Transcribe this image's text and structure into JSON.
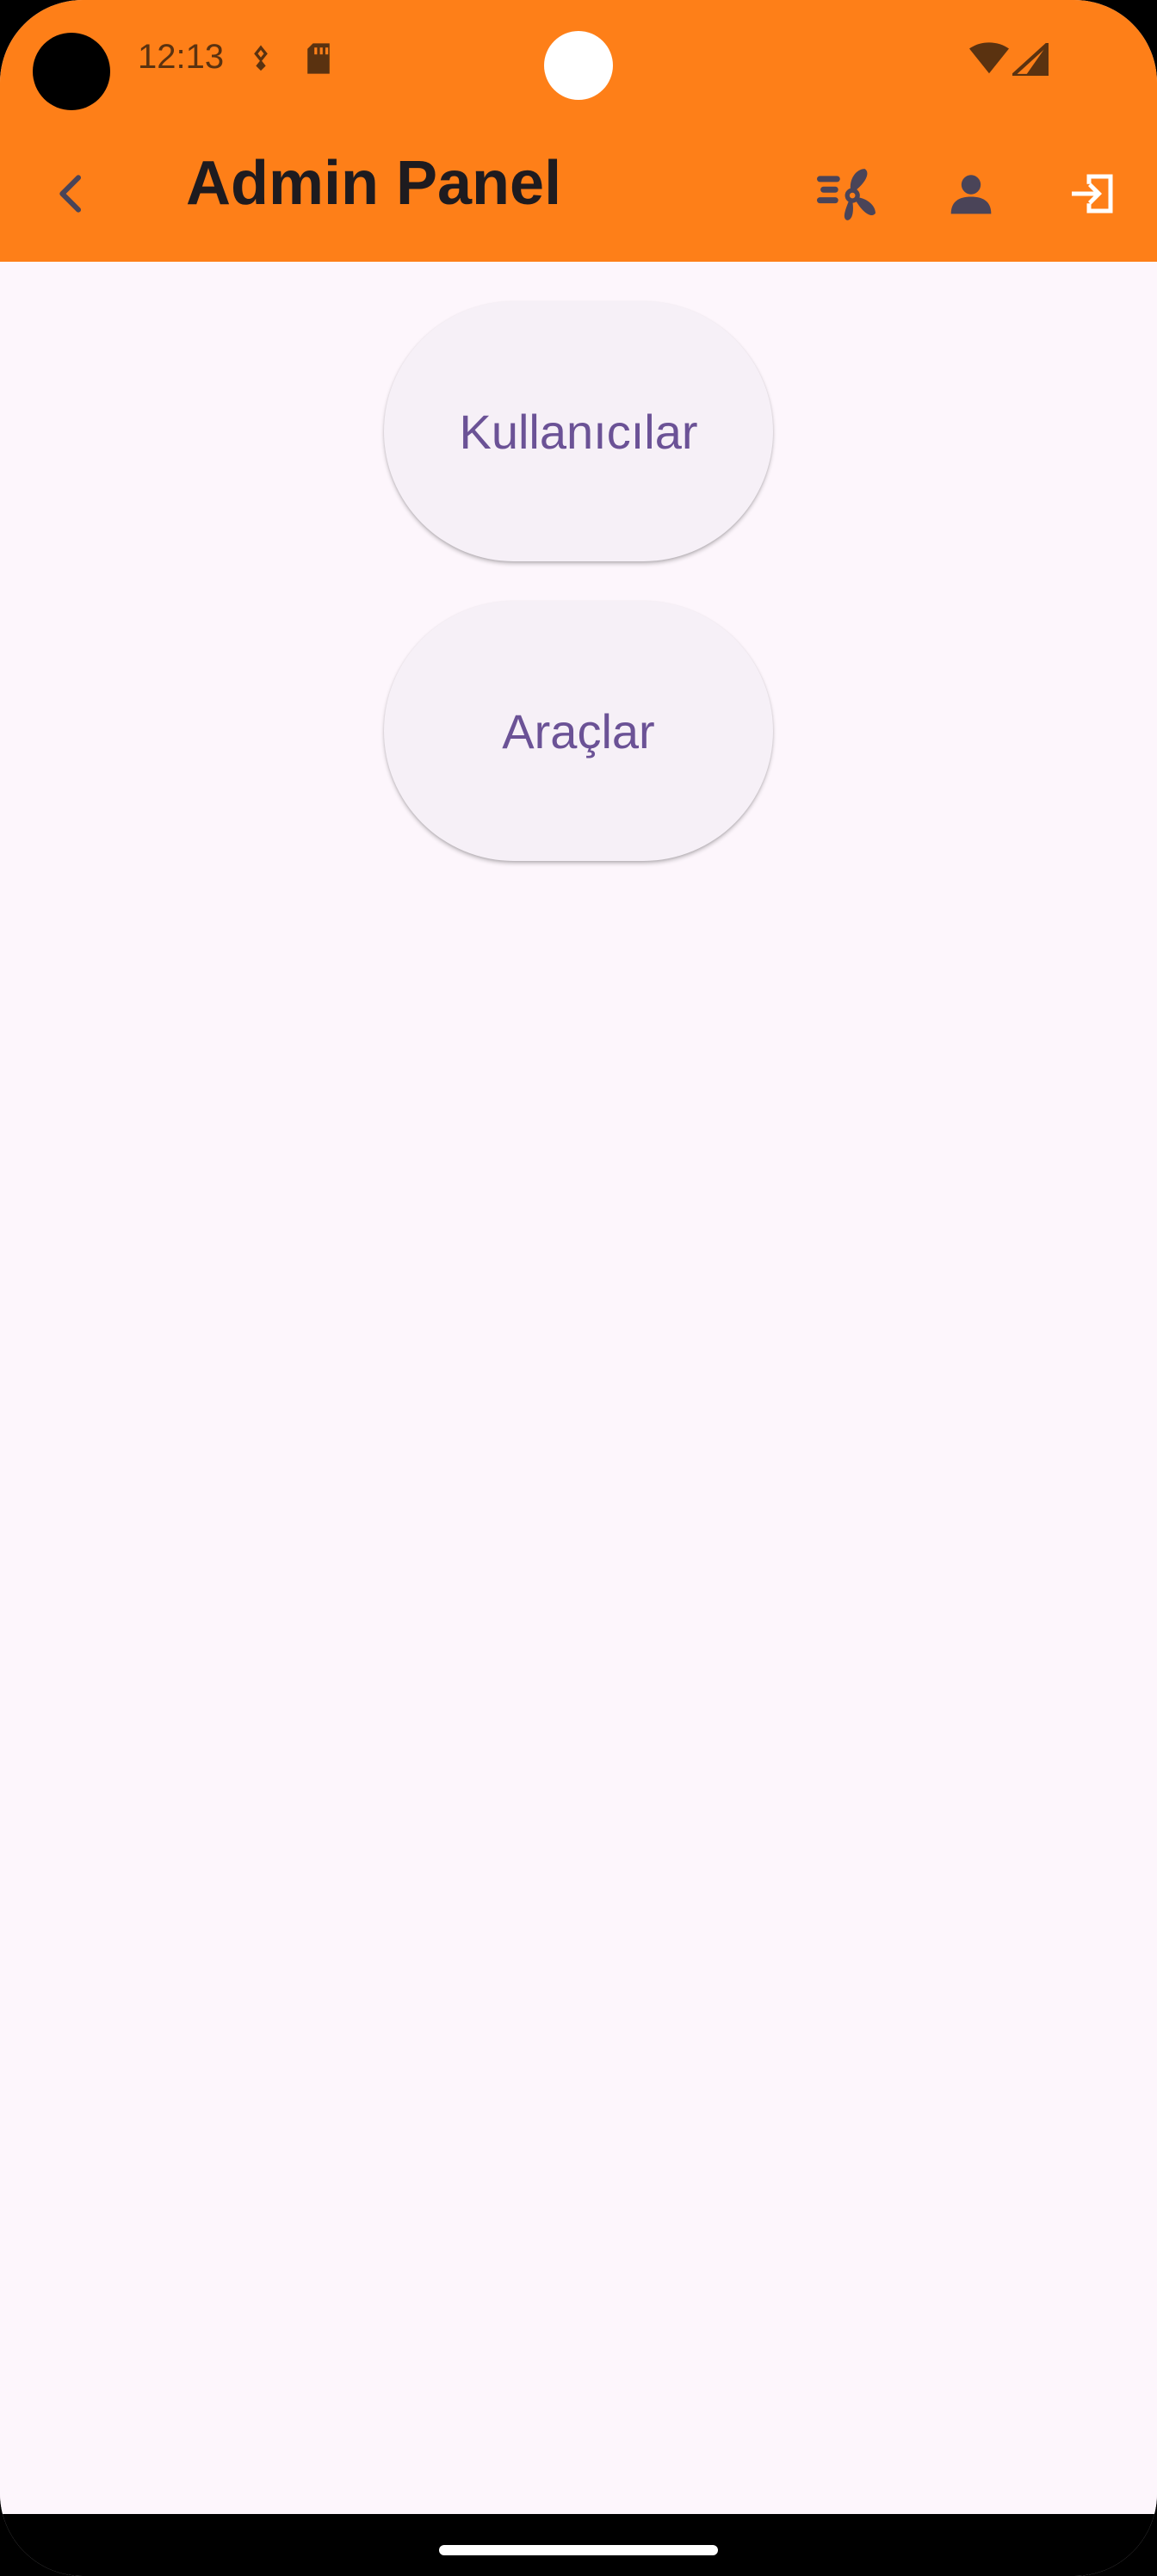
{
  "status_bar": {
    "time": "12:13",
    "icons": [
      "notification-icon",
      "sd-card-icon",
      "wifi-icon",
      "cellular-signal-icon"
    ]
  },
  "app_bar": {
    "title": "Admin Panel",
    "back_icon": "arrow-back-icon",
    "actions": [
      "ceiling-fan-icon",
      "person-icon",
      "logout-icon"
    ]
  },
  "menu": {
    "buttons": [
      {
        "label": "Kullanıcılar"
      },
      {
        "label": "Araçlar"
      }
    ]
  },
  "colors": {
    "app_bar": "#FE7F18",
    "background": "#FDF6FC",
    "button_surface": "#F6F0F7",
    "button_text": "#6B5296",
    "icon": "#4A4458"
  }
}
